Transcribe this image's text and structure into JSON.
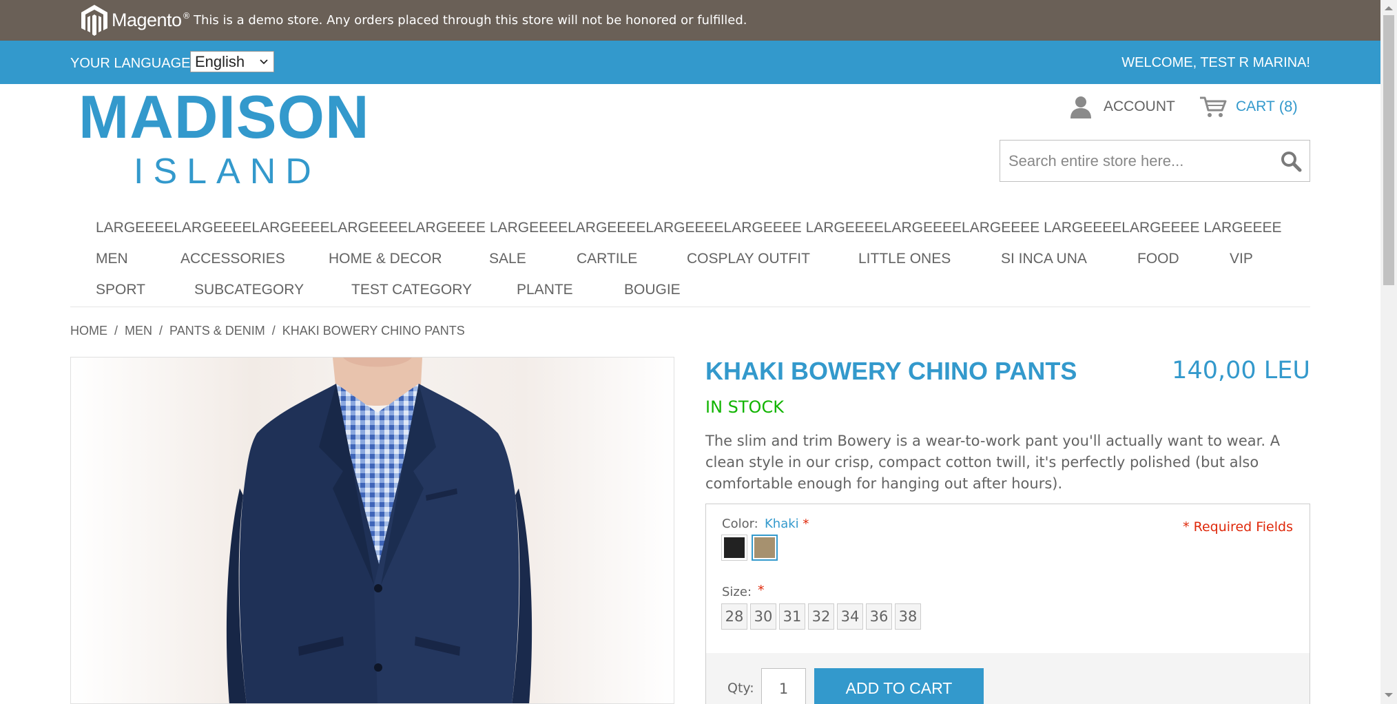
{
  "demo_bar": {
    "logo_text": "Magento",
    "logo_mark": "®",
    "notice": "This is a demo store. Any orders placed through this store will not be honored or fulfilled."
  },
  "header": {
    "language_label": "YOUR LANGUAGE:",
    "language_selected": "English",
    "welcome": "WELCOME, TEST R MARINA!",
    "logo_line1": "MADISON",
    "logo_line2": "ISLAND",
    "account_label": "ACCOUNT",
    "cart_label": "CART",
    "cart_count": "(8)",
    "search_placeholder": "Search entire store here..."
  },
  "nav": {
    "row1": [
      "LARGEEEELARGEEEELARGEEEELARGEEEELARGEEEE LARGEEEELARGEEEELARGEEEELARGEEEE LARGEEEELARGEEEELARGEEEE LARGEEEELARGEEEE LARGEEEE"
    ],
    "row2": [
      "MEN",
      "ACCESSORIES",
      "HOME & DECOR",
      "SALE",
      "CARTILE",
      "COSPLAY OUTFIT",
      "LITTLE ONES",
      "SI INCA UNA",
      "FOOD",
      "VIP"
    ],
    "row3": [
      "SPORT",
      "SUBCATEGORY",
      "TEST CATEGORY",
      "PLANTE",
      "BOUGIE"
    ]
  },
  "breadcrumb": {
    "items": [
      "HOME",
      "MEN",
      "PANTS & DENIM",
      "KHAKI BOWERY CHINO PANTS"
    ],
    "separator": "/"
  },
  "product": {
    "name": "KHAKI BOWERY CHINO PANTS",
    "price": "140,00 LEU",
    "stock": "IN STOCK",
    "description": "The slim and trim Bowery is a wear-to-work pant you'll actually want to wear. A clean style in our crisp, compact cotton twill, it's perfectly polished (but also comfortable enough for hanging out after hours).",
    "color_label": "Color:",
    "color_value": "Khaki",
    "required_star": "*",
    "required_fields": "* Required Fields",
    "swatches": [
      {
        "name": "black",
        "color": "#222222"
      },
      {
        "name": "khaki",
        "color": "#a6916f"
      }
    ],
    "size_label": "Size:",
    "sizes": [
      "28",
      "30",
      "31",
      "32",
      "34",
      "36",
      "38"
    ],
    "qty_label": "Qty:",
    "qty_value": "1",
    "add_to_cart": "ADD TO CART"
  },
  "colors": {
    "accent": "#3399cc",
    "demo_bar": "#6a6057",
    "in_stock": "#11b400",
    "required": "#df280a"
  }
}
